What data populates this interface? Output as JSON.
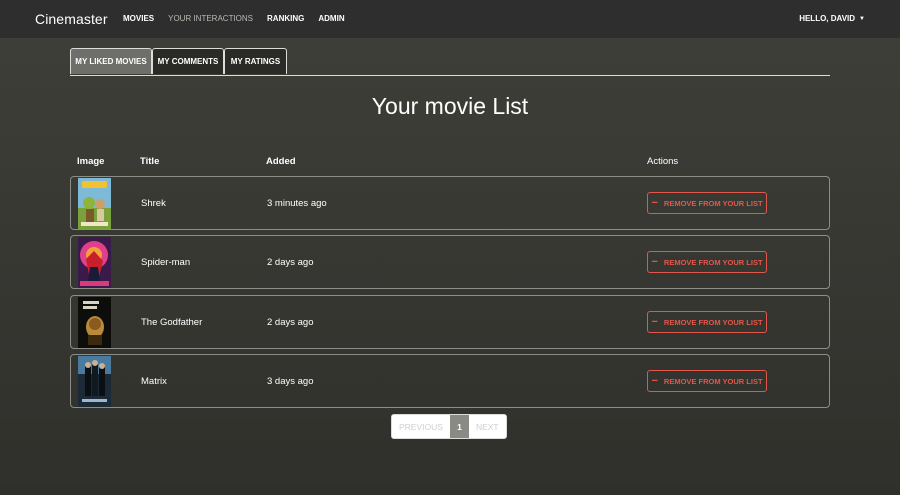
{
  "navbar": {
    "brand": "Cinemaster",
    "links": [
      {
        "label": "MOVIES"
      },
      {
        "label": "YOUR INTERACTIONS"
      },
      {
        "label": "RANKING"
      },
      {
        "label": "ADMIN"
      }
    ],
    "user_label": "HELLO, DAVID",
    "user_caret": "▼"
  },
  "tabs": [
    {
      "label": "MY LIKED MOVIES",
      "active": true
    },
    {
      "label": "MY COMMENTS",
      "active": false
    },
    {
      "label": "MY RATINGS",
      "active": false
    }
  ],
  "page_title": "Your movie List",
  "table": {
    "columns": [
      "Image",
      "Title",
      "Added",
      "Actions"
    ],
    "rows": [
      {
        "title": "Shrek",
        "added": "3 minutes ago",
        "action": "REMOVE FROM YOUR LIST",
        "poster_icon": "shrek-poster"
      },
      {
        "title": "Spider-man",
        "added": "2 days ago",
        "action": "REMOVE FROM YOUR LIST",
        "poster_icon": "spider-man-poster"
      },
      {
        "title": "The Godfather",
        "added": "2 days ago",
        "action": "REMOVE FROM YOUR LIST",
        "poster_icon": "godfather-poster"
      },
      {
        "title": "Matrix",
        "added": "3 days ago",
        "action": "REMOVE FROM YOUR LIST",
        "poster_icon": "matrix-poster"
      }
    ]
  },
  "pagination": {
    "previous": "PREVIOUS",
    "current": "1",
    "next": "NEXT"
  },
  "colors": {
    "accent_remove": "#e2574c",
    "navbar": "#2e2e2e"
  }
}
